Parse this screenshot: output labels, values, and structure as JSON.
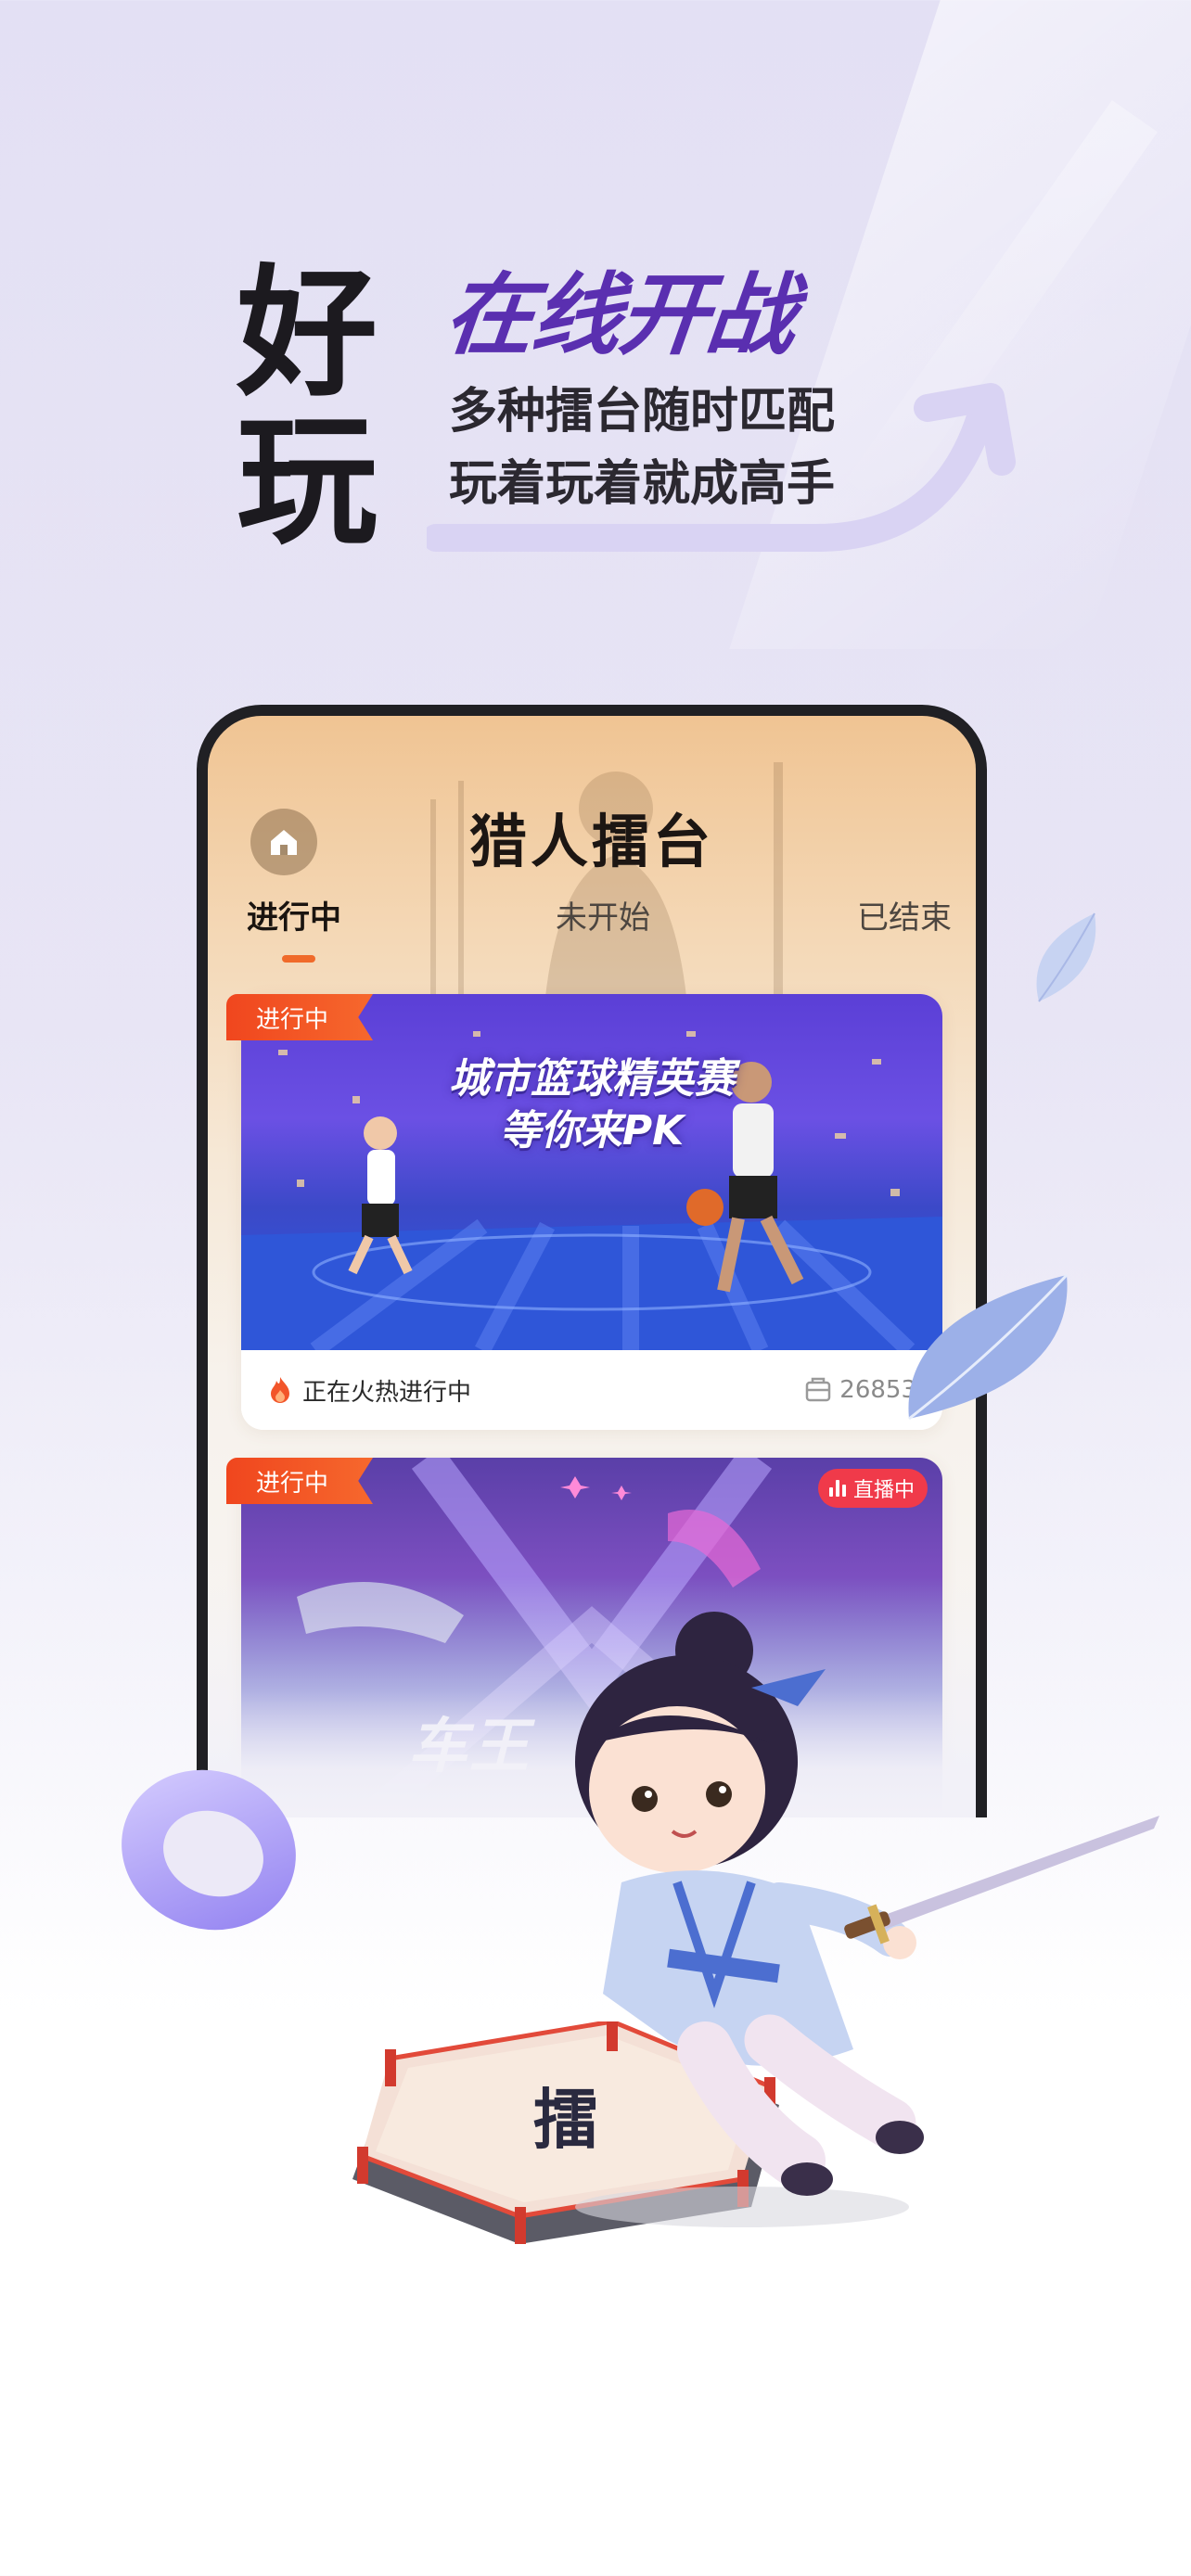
{
  "hero": {
    "big_char_1": "好",
    "big_char_2": "玩",
    "headline": "在线开战",
    "sub_line_1": "多种擂台随时匹配",
    "sub_line_2": "玩着玩着就成高手"
  },
  "app": {
    "title": "猎人擂台",
    "home_icon": "home-icon",
    "tabs": [
      {
        "label": "进行中",
        "active": true
      },
      {
        "label": "未开始",
        "active": false
      },
      {
        "label": "已结束",
        "active": false
      }
    ]
  },
  "cards": [
    {
      "tag": "进行中",
      "banner_line_1": "城市篮球精英赛",
      "banner_line_2": "等你来PK",
      "status_text": "正在火热进行中",
      "count": "26853",
      "status_icon": "fire-icon",
      "count_icon": "ticket-icon"
    },
    {
      "tag": "进行中",
      "live_label": "直播中",
      "banner_text": "车王"
    }
  ],
  "illustration": {
    "stage_char": "擂"
  },
  "colors": {
    "accent_purple": "#5a2fb0",
    "tag_orange": "#f0461e",
    "live_red": "#f03a4a",
    "tab_indicator": "#f06a2a"
  }
}
